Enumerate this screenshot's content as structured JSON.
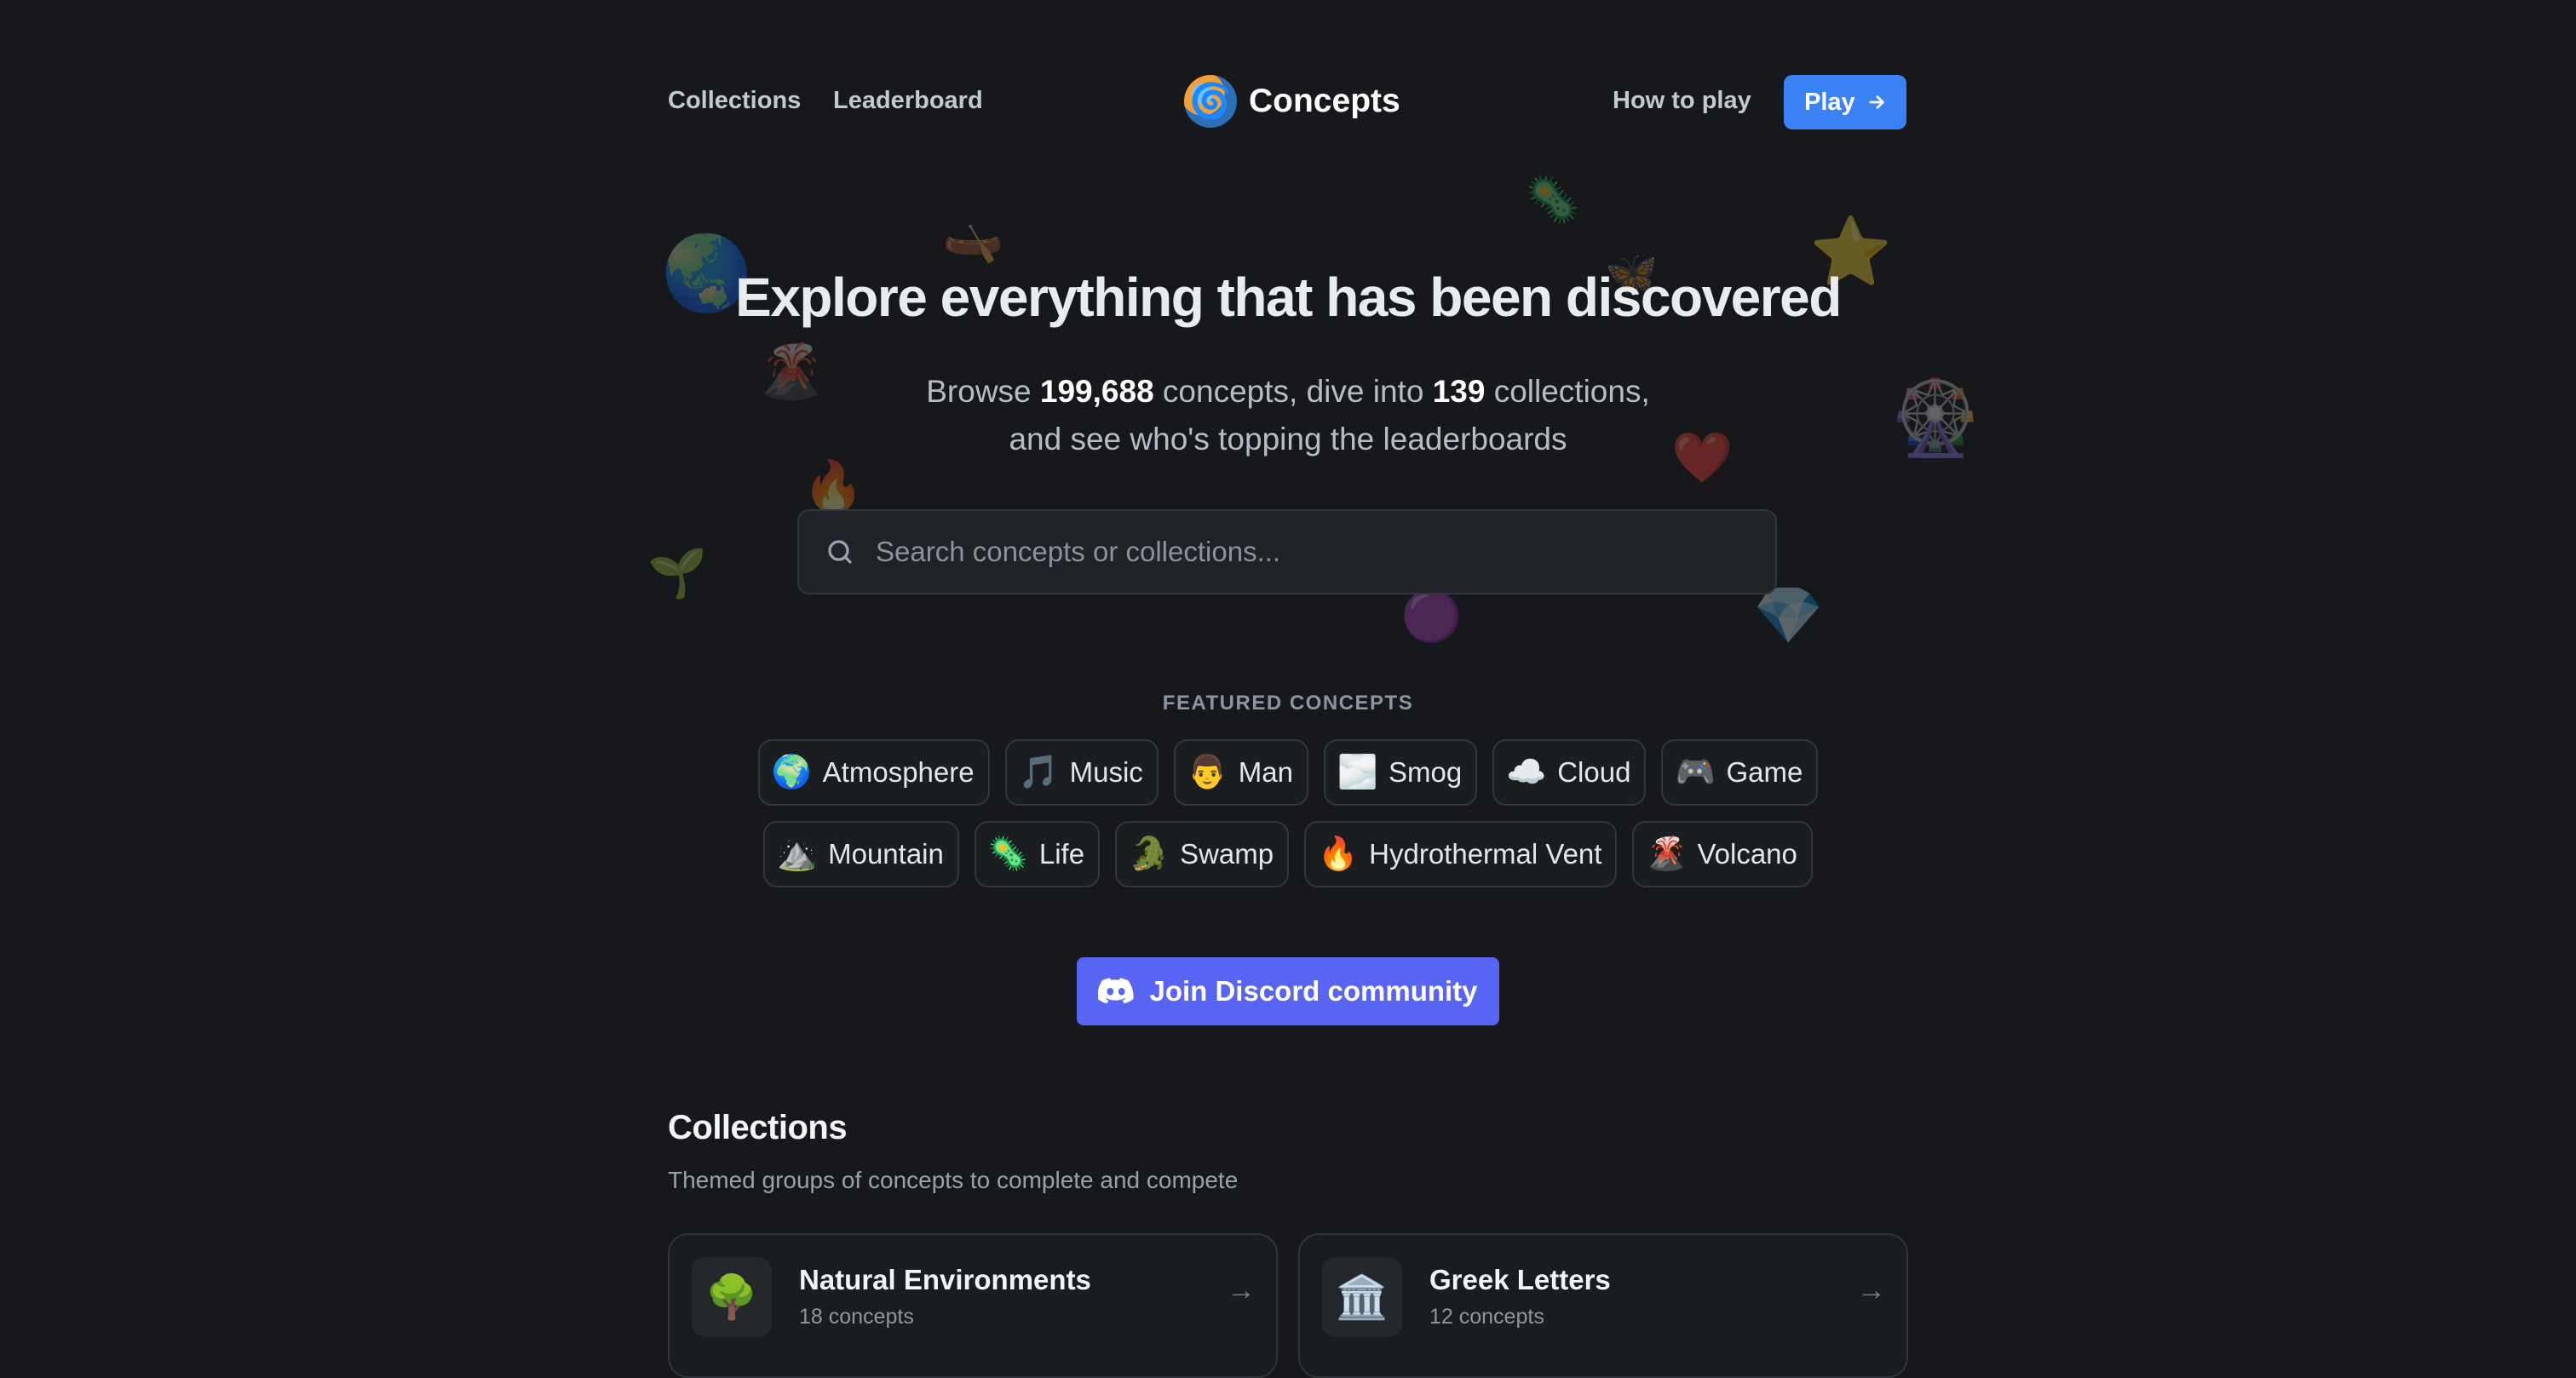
{
  "nav": {
    "collections": "Collections",
    "leaderboard": "Leaderboard",
    "brand": "Concepts",
    "how_to_play": "How to play",
    "play": "Play"
  },
  "hero": {
    "title": "Explore everything that has been discovered",
    "sub_prefix": "Browse ",
    "concept_count": "199,688",
    "sub_mid": " concepts, dive into ",
    "collection_count": "139",
    "sub_suffix": " collections,",
    "sub_line2": "and see who's topping the leaderboards"
  },
  "search": {
    "placeholder": "Search concepts or collections..."
  },
  "featured": {
    "label": "FEATURED CONCEPTS",
    "row1": [
      {
        "emoji": "🌍",
        "label": "Atmosphere"
      },
      {
        "emoji": "🎵",
        "label": "Music"
      },
      {
        "emoji": "👨",
        "label": "Man"
      },
      {
        "emoji": "🌫️",
        "label": "Smog"
      },
      {
        "emoji": "☁️",
        "label": "Cloud"
      },
      {
        "emoji": "🎮",
        "label": "Game"
      }
    ],
    "row2": [
      {
        "emoji": "⛰️",
        "label": "Mountain"
      },
      {
        "emoji": "🦠",
        "label": "Life"
      },
      {
        "emoji": "🐊",
        "label": "Swamp"
      },
      {
        "emoji": "🔥",
        "label": "Hydrothermal Vent"
      },
      {
        "emoji": "🌋",
        "label": "Volcano"
      }
    ]
  },
  "discord": {
    "label": "Join Discord community"
  },
  "collections": {
    "title": "Collections",
    "subtitle": "Themed groups of concepts to complete and compete",
    "cards": [
      {
        "emoji": "🌳",
        "title": "Natural Environments",
        "count": "18 concepts"
      },
      {
        "emoji": "🏛️",
        "title": "Greek Letters",
        "count": "12 concepts"
      }
    ]
  },
  "decor": [
    "🌏",
    "🛶",
    "🦠",
    "⭐",
    "🦋",
    "🌋",
    "🎡",
    "❤️",
    "🔥",
    "🌱",
    "💎",
    "🟣"
  ]
}
